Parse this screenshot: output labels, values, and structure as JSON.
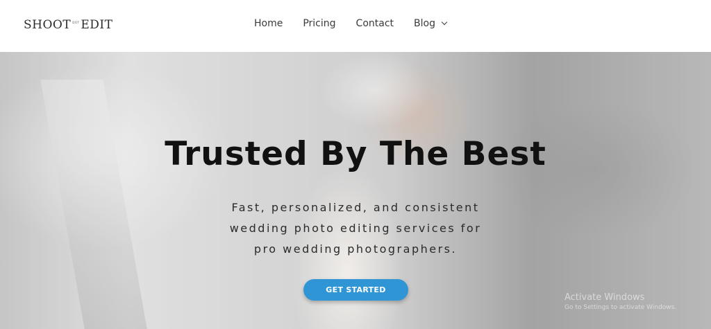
{
  "header": {
    "logo": {
      "left": "SHOOT",
      "dot": "DOT",
      "right": "EDIT"
    },
    "nav": [
      {
        "label": "Home"
      },
      {
        "label": "Pricing"
      },
      {
        "label": "Contact"
      },
      {
        "label": "Blog",
        "has_dropdown": true
      }
    ]
  },
  "hero": {
    "title": "Trusted By The Best",
    "subtitle_lines": [
      "Fast, personalized, and consistent",
      "wedding photo editing services for",
      "pro wedding photographers."
    ],
    "cta_label": "GET STARTED",
    "cta_color": "#2f95d5"
  },
  "watermark": {
    "line1": "Activate Windows",
    "line2": "Go to Settings to activate Windows."
  }
}
